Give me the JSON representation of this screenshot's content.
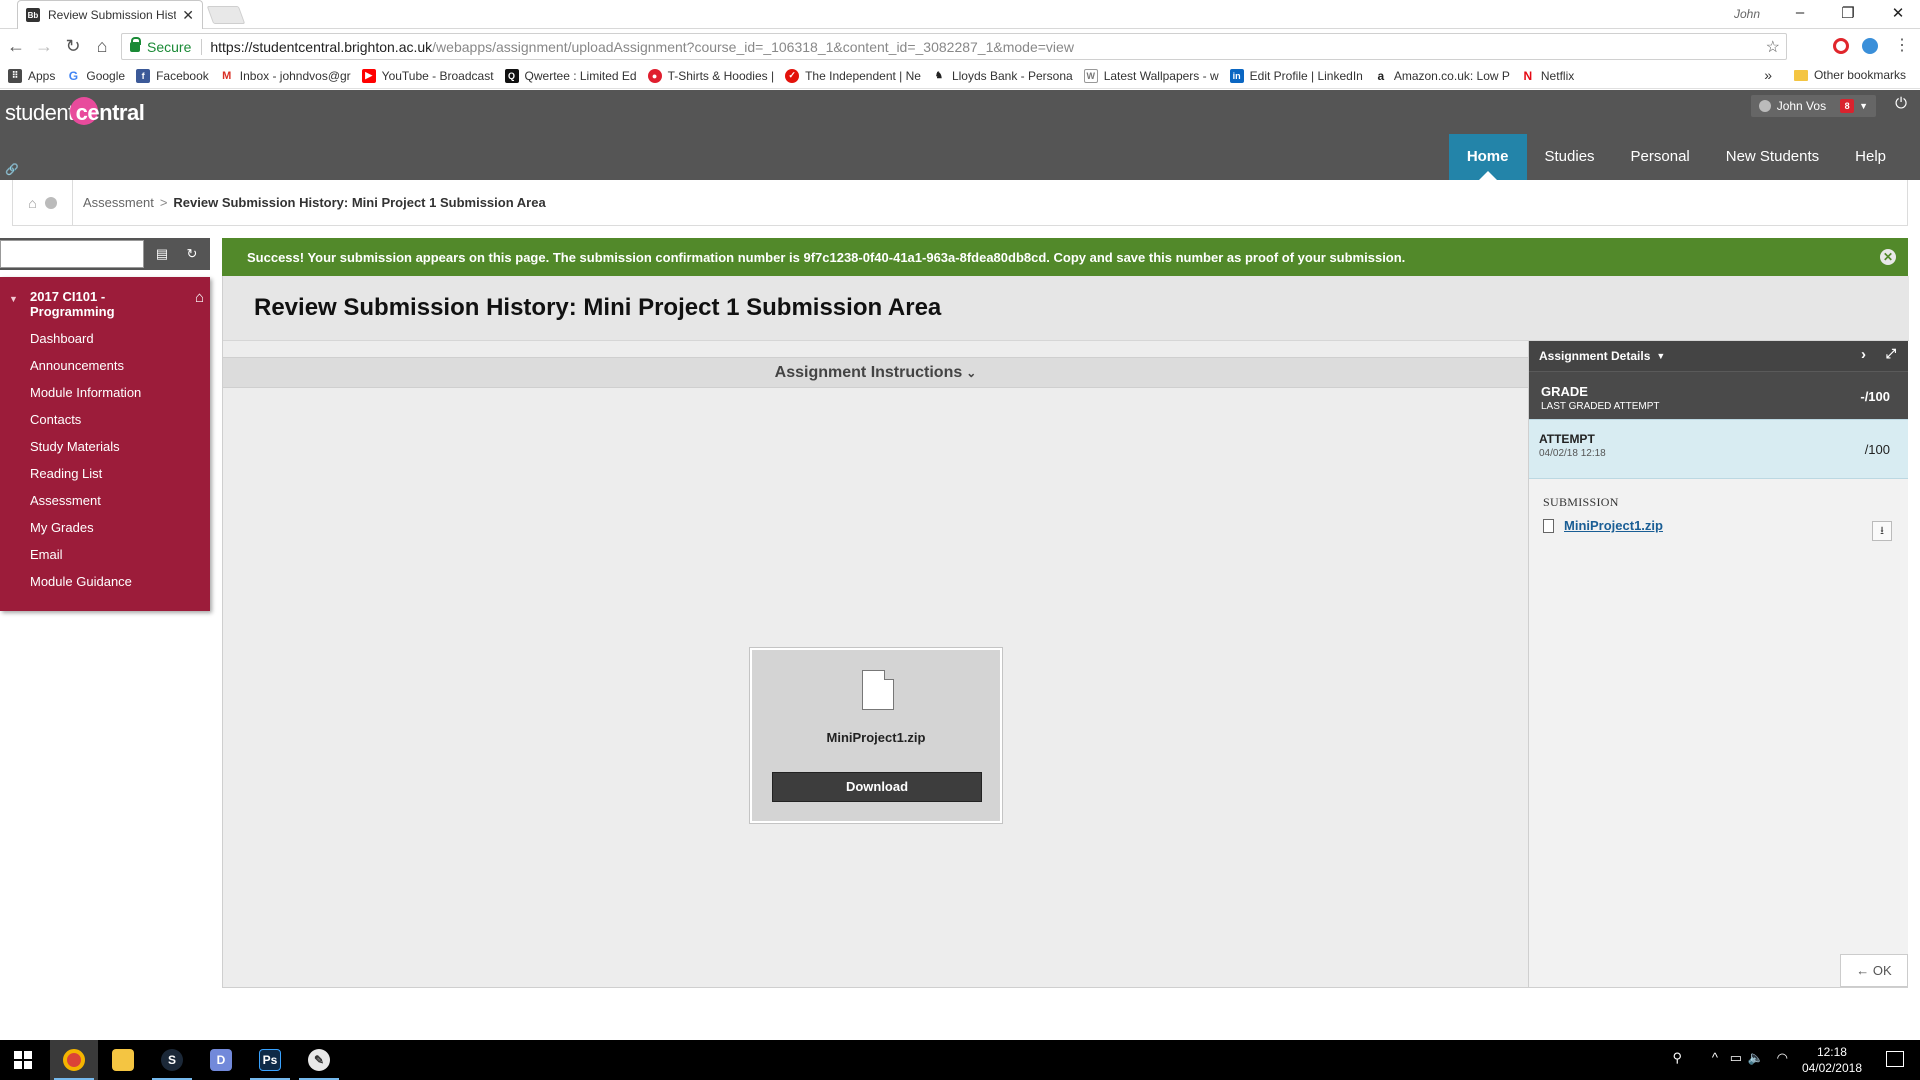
{
  "browser": {
    "tab_title": "Review Submission Histo",
    "tab_favicon": "Bb",
    "profile_name": "John",
    "secure_label": "Secure",
    "url_host": "https://studentcentral.brighton.ac.uk",
    "url_path": "/webapps/assignment/uploadAssignment?course_id=_106318_1&content_id=_3082287_1&mode=view",
    "bookmarks": [
      {
        "label": "Apps",
        "icon": "apps-grid-icon",
        "color": "#4a4a4a"
      },
      {
        "label": "Google",
        "icon": "google-icon",
        "color": "#4285f4"
      },
      {
        "label": "Facebook",
        "icon": "facebook-icon",
        "color": "#3b5998"
      },
      {
        "label": "Inbox - johndvos@gr",
        "icon": "gmail-icon",
        "color": "#d93025"
      },
      {
        "label": "YouTube - Broadcast",
        "icon": "youtube-icon",
        "color": "#ff0000"
      },
      {
        "label": "Qwertee : Limited Ed",
        "icon": "qwertee-icon",
        "color": "#111111"
      },
      {
        "label": "T-Shirts & Hoodies |",
        "icon": "tshirt-site-icon",
        "color": "#e01e2e"
      },
      {
        "label": "The Independent | Ne",
        "icon": "independent-icon",
        "color": "#e3120b"
      },
      {
        "label": "Lloyds Bank - Persona",
        "icon": "lloyds-icon",
        "color": "#222222"
      },
      {
        "label": "Latest Wallpapers - w",
        "icon": "wallpapers-icon",
        "color": "#777777"
      },
      {
        "label": "Edit Profile | LinkedIn",
        "icon": "linkedin-icon",
        "color": "#0a66c2"
      },
      {
        "label": "Amazon.co.uk: Low P",
        "icon": "amazon-icon",
        "color": "#222222"
      },
      {
        "label": "Netflix",
        "icon": "netflix-icon",
        "color": "#e50914"
      }
    ],
    "bookmarks_more": "»",
    "other_bookmarks": "Other bookmarks"
  },
  "header": {
    "logo_left": "student",
    "logo_right": "central",
    "user_name": "John Vos",
    "badge": "8",
    "nav": [
      "Home",
      "Studies",
      "Personal",
      "New Students",
      "Help"
    ],
    "active_nav": "Home"
  },
  "breadcrumb": {
    "parent": "Assessment",
    "separator": ">",
    "current": "Review Submission History: Mini Project 1 Submission Area"
  },
  "course_menu": {
    "course_title": "2017 CI101 - Programming",
    "items": [
      "Dashboard",
      "Announcements",
      "Module Information",
      "Contacts",
      "Study Materials",
      "Reading List",
      "Assessment",
      "My Grades",
      "Email",
      "Module Guidance"
    ]
  },
  "banner": {
    "message": "Success! Your submission appears on this page. The submission confirmation number is 9f7c1238-0f40-41a1-963a-8fdea80db8cd. Copy and save this number as proof of your submission.",
    "color": "#52892a"
  },
  "main": {
    "title": "Review Submission History: Mini Project 1 Submission Area",
    "instructions_label": "Assignment Instructions",
    "file_name": "MiniProject1.zip",
    "download_label": "Download"
  },
  "details": {
    "header": "Assignment Details",
    "grade_label": "GRADE",
    "grade_sub": "LAST GRADED ATTEMPT",
    "grade_value": "-/100",
    "attempt_label": "ATTEMPT",
    "attempt_date": "04/02/18 12:18",
    "attempt_value": "/100",
    "submission_label": "SUBMISSION",
    "submission_file": "MiniProject1.zip",
    "ok_label": "← OK"
  },
  "taskbar": {
    "time": "12:18",
    "date": "04/02/2018"
  },
  "colors": {
    "header_bg": "#555555",
    "nav_active": "#2384a9",
    "menu_bg": "#9c1c3a",
    "brand_pink": "#e84b9c"
  }
}
